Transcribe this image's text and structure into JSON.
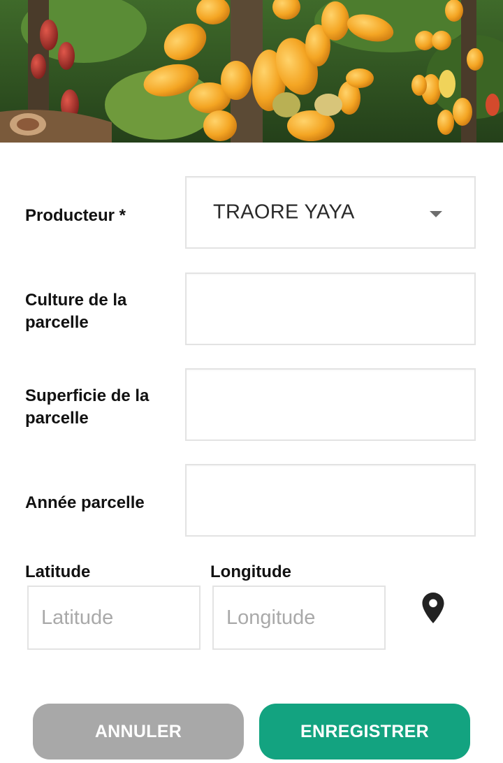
{
  "form": {
    "producer": {
      "label": "Producteur *",
      "value": "TRAORE YAYA"
    },
    "culture": {
      "label": "Culture de la parcelle",
      "value": ""
    },
    "superficie": {
      "label": "Superficie de la parcelle",
      "value": ""
    },
    "annee": {
      "label": "Année parcelle",
      "value": ""
    },
    "latitude": {
      "label": "Latitude",
      "placeholder": "Latitude",
      "value": ""
    },
    "longitude": {
      "label": "Longitude",
      "placeholder": "Longitude",
      "value": ""
    }
  },
  "icons": {
    "dropdown": "caret-down-icon",
    "location": "map-pin-icon"
  },
  "actions": {
    "cancel_label": "ANNULER",
    "save_label": "ENREGISTRER"
  },
  "colors": {
    "primary": "#13a380",
    "cancel": "#a8a8a8",
    "field_border": "#e3e3e3",
    "text": "#111111",
    "placeholder": "#a9a9a9"
  }
}
